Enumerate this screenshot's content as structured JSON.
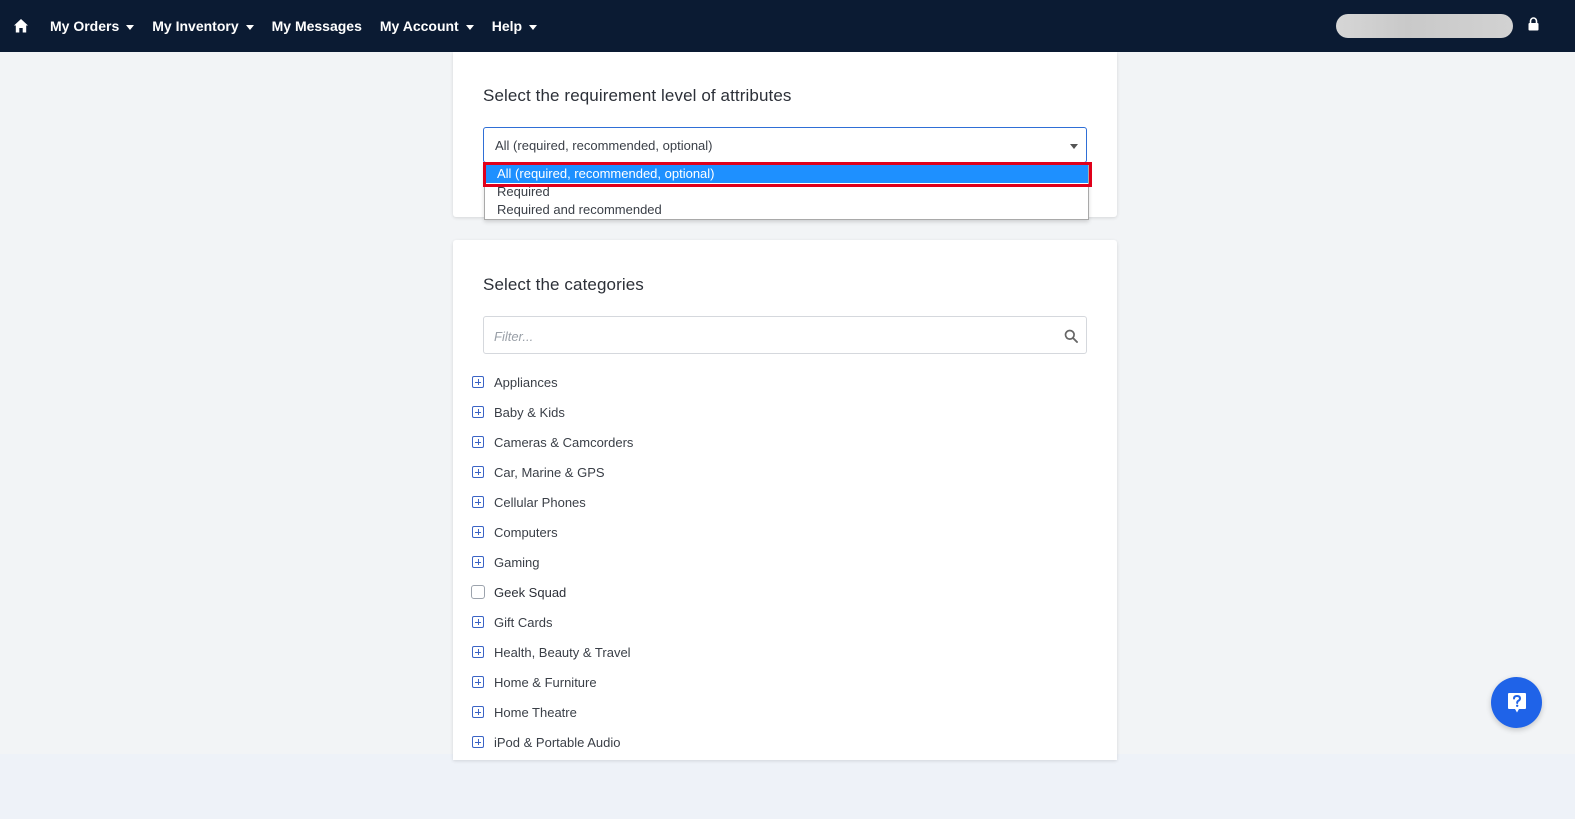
{
  "nav": {
    "items": [
      {
        "label": "My Orders",
        "has_caret": true
      },
      {
        "label": "My Inventory",
        "has_caret": true
      },
      {
        "label": "My Messages",
        "has_caret": false
      },
      {
        "label": "My Account",
        "has_caret": true
      },
      {
        "label": "Help",
        "has_caret": true
      }
    ],
    "home_icon": "home-icon",
    "lock_icon": "lock-icon",
    "colors": {
      "background": "#0b1b33",
      "text": "#ffffff"
    }
  },
  "requirement": {
    "title": "Select the requirement level of attributes",
    "selected_value": "All (required, recommended, optional)",
    "options": [
      "All (required, recommended, optional)",
      "Required",
      "Required and recommended"
    ],
    "highlighted_option_color": "#1e90ff",
    "annotation_color": "#e0001a"
  },
  "categories": {
    "title": "Select the categories",
    "filter_placeholder": "Filter...",
    "search_icon": "search-icon",
    "items": [
      {
        "label": "Appliances",
        "kind": "expand"
      },
      {
        "label": "Baby & Kids",
        "kind": "expand"
      },
      {
        "label": "Cameras & Camcorders",
        "kind": "expand"
      },
      {
        "label": "Car, Marine & GPS",
        "kind": "expand"
      },
      {
        "label": "Cellular Phones",
        "kind": "expand"
      },
      {
        "label": "Computers",
        "kind": "expand"
      },
      {
        "label": "Gaming",
        "kind": "expand"
      },
      {
        "label": "Geek Squad",
        "kind": "checkbox"
      },
      {
        "label": "Gift Cards",
        "kind": "expand"
      },
      {
        "label": "Health, Beauty & Travel",
        "kind": "expand"
      },
      {
        "label": "Home & Furniture",
        "kind": "expand"
      },
      {
        "label": "Home Theatre",
        "kind": "expand"
      },
      {
        "label": "iPod & Portable Audio",
        "kind": "expand"
      }
    ]
  },
  "help_button": {
    "icon": "question-icon",
    "color": "#1f63e8"
  }
}
